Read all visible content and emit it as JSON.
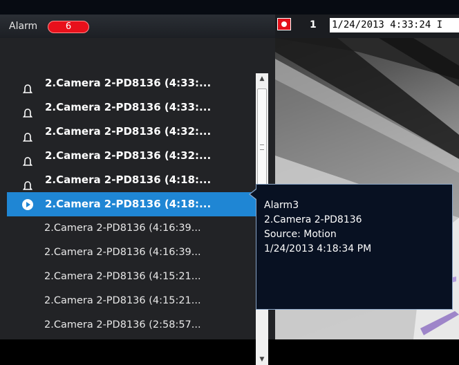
{
  "alarm_panel": {
    "title": "Alarm",
    "badge_count": "6",
    "items": [
      {
        "label": "2.Camera 2-PD8136 (4:33:...",
        "style": "unread",
        "icon": "bell-icon"
      },
      {
        "label": "2.Camera 2-PD8136 (4:33:...",
        "style": "unread",
        "icon": "bell-icon"
      },
      {
        "label": "2.Camera 2-PD8136 (4:32:...",
        "style": "unread",
        "icon": "bell-icon"
      },
      {
        "label": "2.Camera 2-PD8136 (4:32:...",
        "style": "unread",
        "icon": "bell-icon"
      },
      {
        "label": "2.Camera 2-PD8136 (4:18:...",
        "style": "unread",
        "icon": "bell-icon"
      },
      {
        "label": "2.Camera 2-PD8136 (4:18:...",
        "style": "selected",
        "icon": "play-icon"
      },
      {
        "label": "2.Camera 2-PD8136 (4:16:39...",
        "style": "read"
      },
      {
        "label": "2.Camera 2-PD8136 (4:16:39...",
        "style": "read"
      },
      {
        "label": "2.Camera 2-PD8136 (4:15:21...",
        "style": "read"
      },
      {
        "label": "2.Camera 2-PD8136 (4:15:21...",
        "style": "read"
      },
      {
        "label": "2.Camera 2-PD8136 (2:58:57...",
        "style": "read"
      }
    ]
  },
  "tooltip": {
    "line1": "Alarm3",
    "line2": "2.Camera 2-PD8136",
    "line3": "Source: Motion",
    "line4": "1/24/2013 4:18:34 PM"
  },
  "camera_bar": {
    "camera_number": "1",
    "timestamp": "1/24/2013 4:33:24 I"
  },
  "colors": {
    "selected_row": "#1f86d4",
    "badge": "#e8101b",
    "record_button": "#e3101a",
    "tooltip_bg": "#081122"
  }
}
